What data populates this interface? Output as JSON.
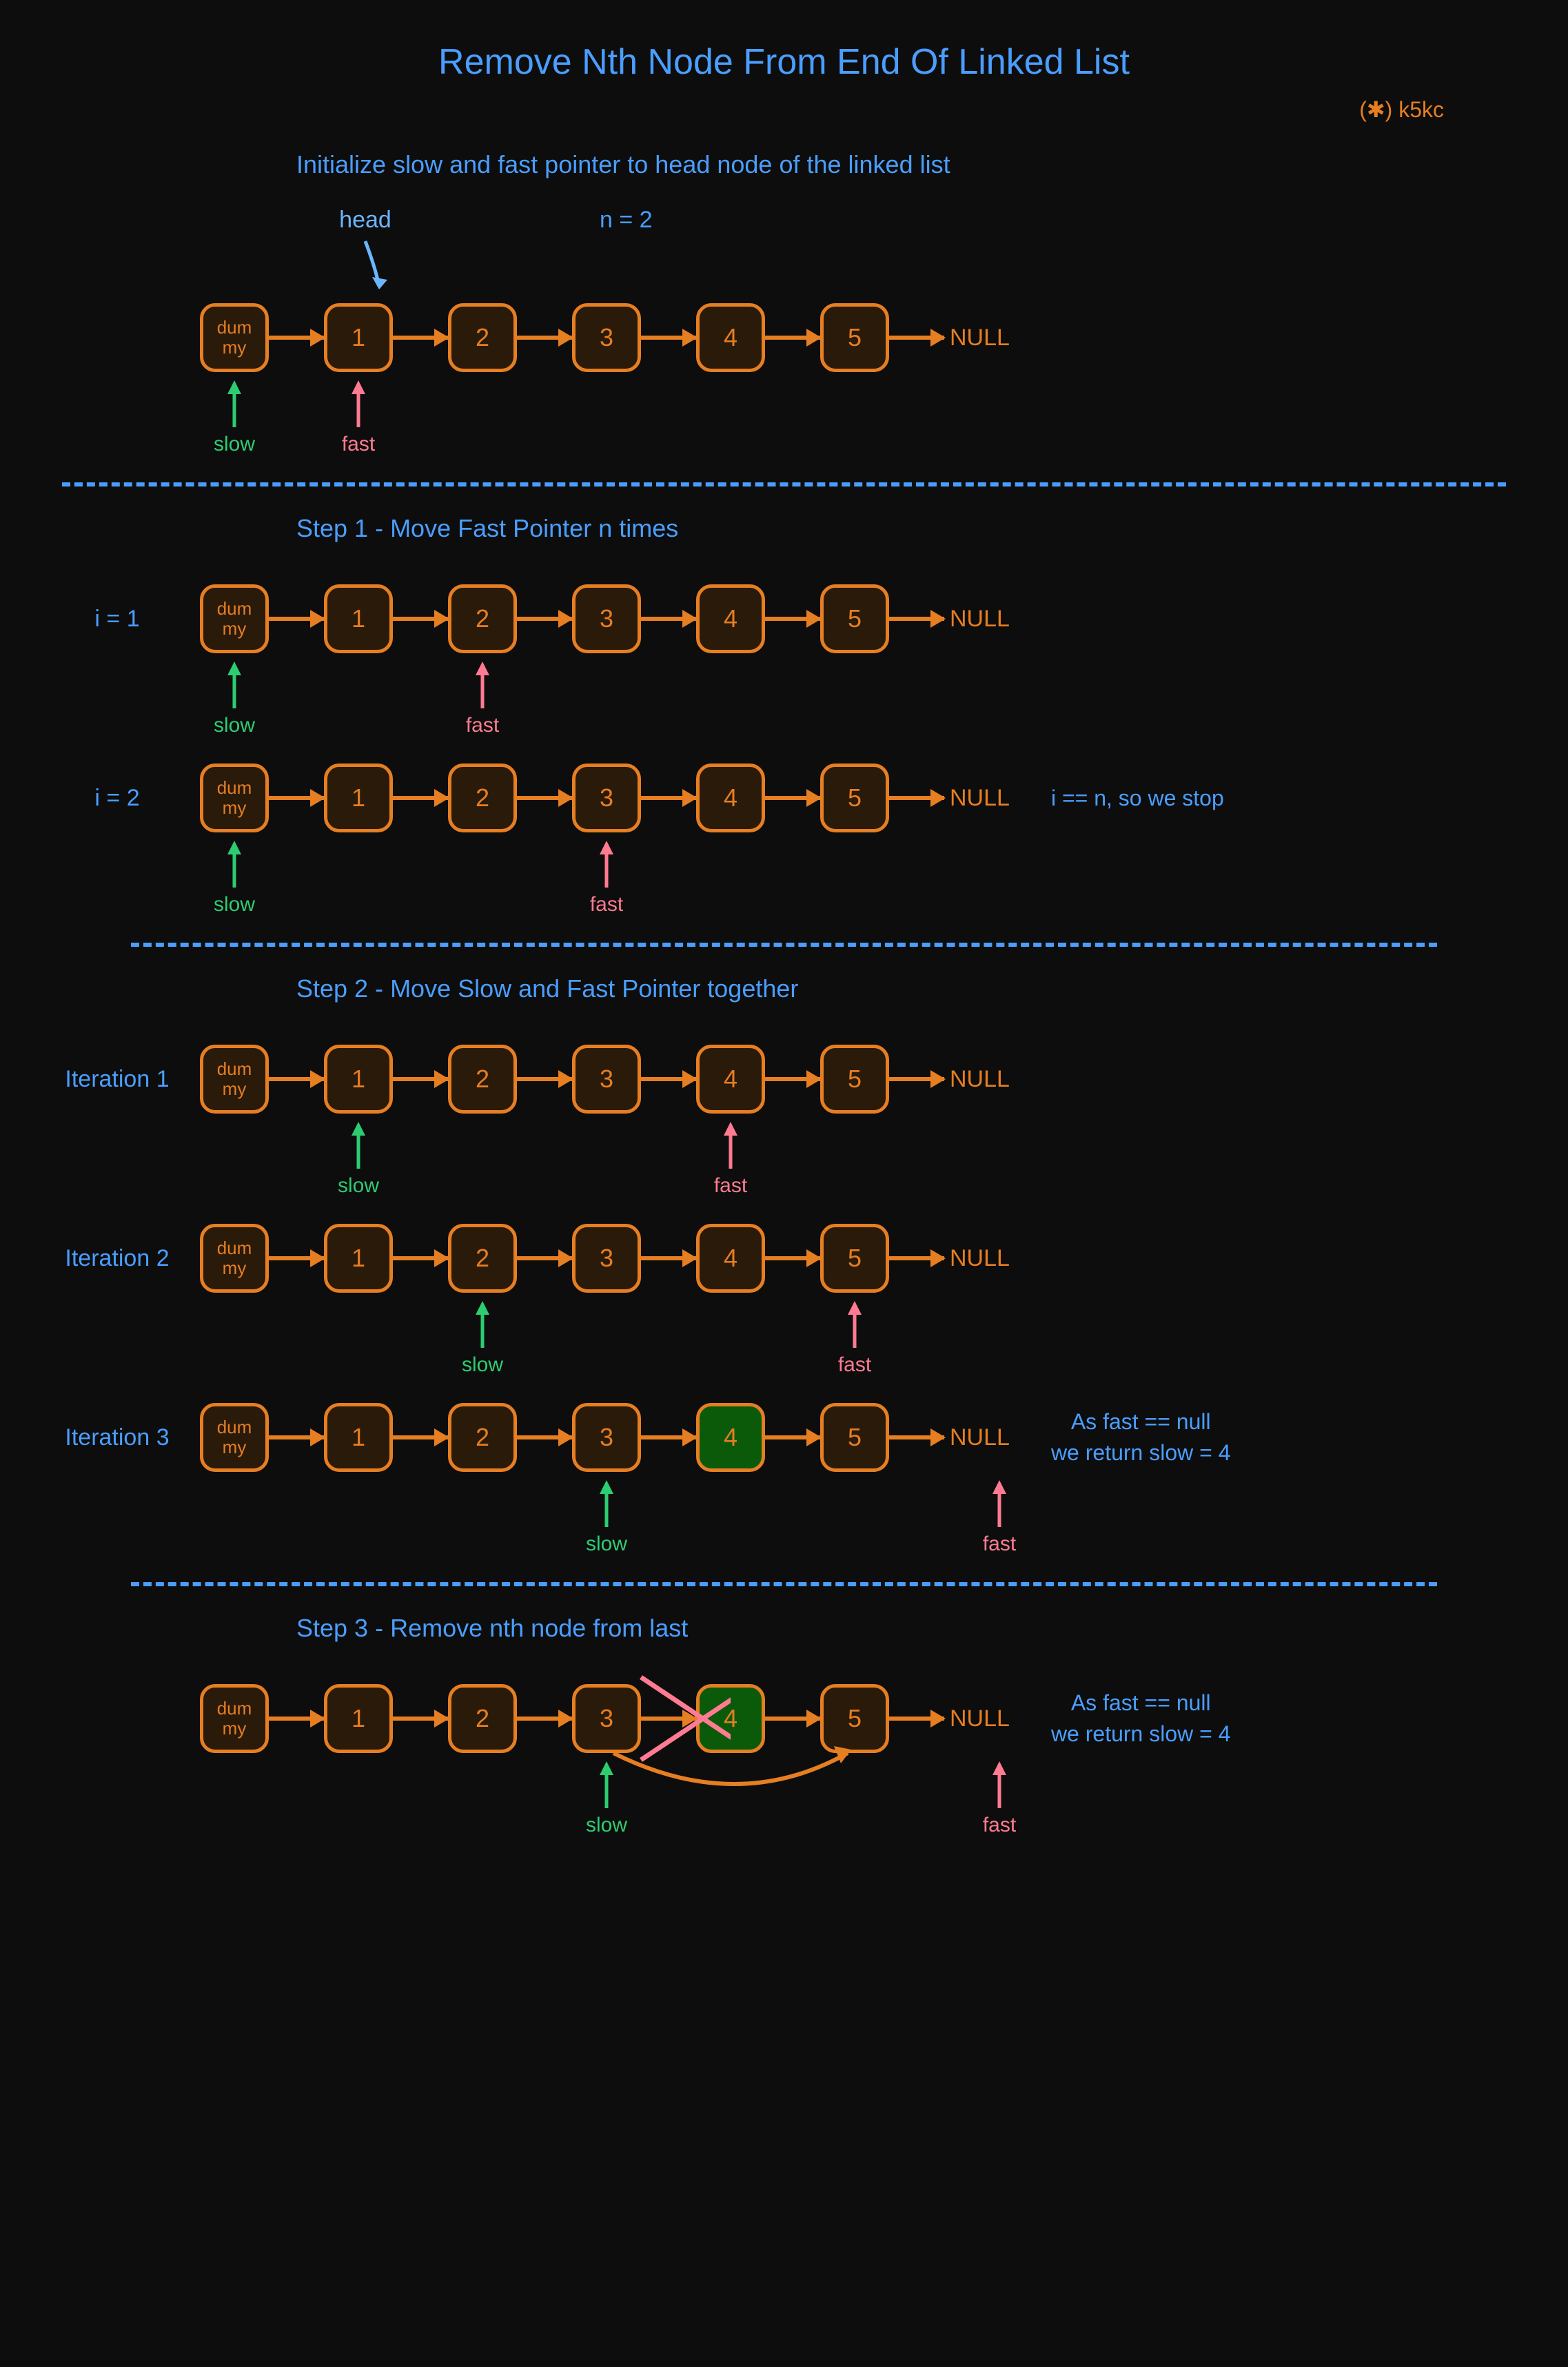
{
  "title": "Remove Nth Node From End Of Linked List",
  "watermark": "(✱) k5kc",
  "head_label": "head",
  "n_label": "n = 2",
  "null_label": "NULL",
  "dummy_label": "dum\nmy",
  "slow_label": "slow",
  "fast_label": "fast",
  "nodes": [
    "1",
    "2",
    "3",
    "4",
    "5"
  ],
  "sections": {
    "init": "Initialize slow and fast pointer to head node of the linked list",
    "step1": "Step 1 - Move Fast Pointer n times",
    "step2": "Step 2 - Move Slow and Fast Pointer together",
    "step3": "Step 3 - Remove nth node from last"
  },
  "i1": "i = 1",
  "i2": "i = 2",
  "it1": "Iteration 1",
  "it2": "Iteration 2",
  "it3": "Iteration 3",
  "stop_note": "i == n, so we stop",
  "return_note": "As fast == null\nwe return slow = 4"
}
